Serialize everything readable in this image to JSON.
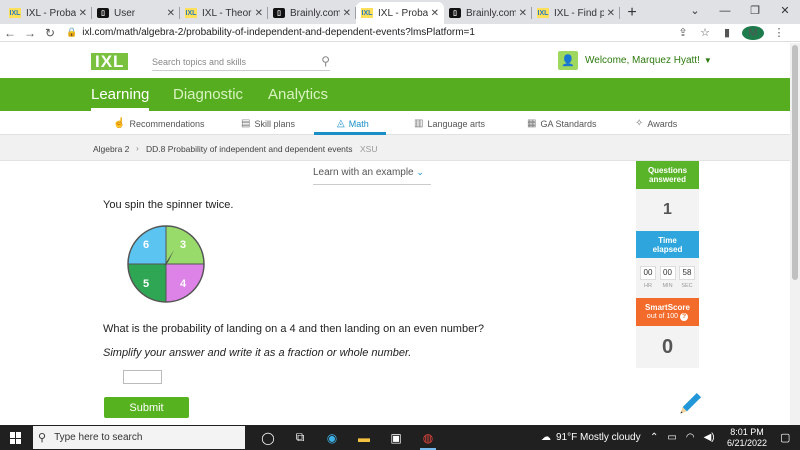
{
  "browser": {
    "tabs": [
      {
        "label": "IXL - Probabilit",
        "icon": "ixl-favicon-icon",
        "active": false
      },
      {
        "label": "User",
        "icon": "brainly-favicon-icon",
        "active": false
      },
      {
        "label": "IXL - Theoretic",
        "icon": "ixl-favicon-icon",
        "active": false
      },
      {
        "label": "Brainly.com - F",
        "icon": "brainly-favicon-icon",
        "active": false
      },
      {
        "label": "IXL - Probabilit",
        "icon": "ixl-favicon-icon",
        "active": true
      },
      {
        "label": "Brainly.com - F",
        "icon": "brainly-favicon-icon",
        "active": false
      },
      {
        "label": "IXL - Find prob",
        "icon": "ixl-favicon-icon",
        "active": false
      }
    ],
    "new_tab": "+",
    "url": "ixl.com/math/algebra-2/probability-of-independent-and-dependent-events?lmsPlatform=1",
    "profile_initial": "M"
  },
  "header": {
    "logo": "IXL",
    "search_placeholder": "Search topics and skills",
    "welcome": "Welcome, Marquez Hyatt!"
  },
  "main_nav": {
    "items": [
      "Learning",
      "Diagnostic",
      "Analytics"
    ],
    "active": "Learning"
  },
  "sub_nav": {
    "items": [
      "Recommendations",
      "Skill plans",
      "Math",
      "Language arts",
      "GA Standards",
      "Awards"
    ],
    "active": "Math"
  },
  "breadcrumb": {
    "subject": "Algebra 2",
    "skill": "DD.8 Probability of independent and dependent events",
    "code": "XSU"
  },
  "learn_example": "Learn with an example",
  "question": {
    "intro": "You spin the spinner twice.",
    "prompt": "What is the probability of landing on a 4 and then landing on an even number?",
    "instruction": "Simplify your answer and write it as a fraction or whole number.",
    "submit_label": "Submit",
    "spinner": {
      "sections": [
        {
          "label": "3",
          "color": "#98db6a"
        },
        {
          "label": "4",
          "color": "#dd82e6"
        },
        {
          "label": "5",
          "color": "#2fa654"
        },
        {
          "label": "6",
          "color": "#5bc4f0"
        }
      ]
    }
  },
  "stats": {
    "questions_answered_label": "Questions answered",
    "questions_answered": "1",
    "time_elapsed_label": "Time elapsed",
    "timer": [
      {
        "value": "00",
        "unit": "HR"
      },
      {
        "value": "00",
        "unit": "MIN"
      },
      {
        "value": "58",
        "unit": "SEC"
      }
    ],
    "smartscore_label": "SmartScore",
    "smartscore_sub": "out of 100",
    "smartscore": "0"
  },
  "taskbar": {
    "search_placeholder": "Type here to search",
    "weather": "91°F  Mostly cloudy",
    "time": "8:01 PM",
    "date": "6/21/2022"
  }
}
